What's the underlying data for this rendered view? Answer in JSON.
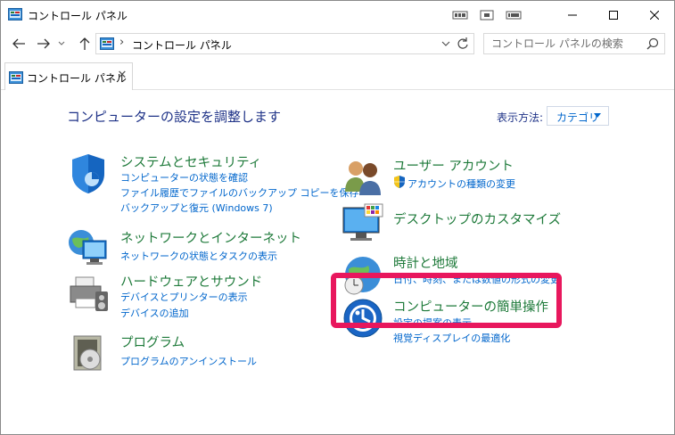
{
  "window": {
    "title": "コントロール パネル",
    "controls": {
      "minimize": "—",
      "maximize": "☐",
      "close": "✕"
    }
  },
  "nav": {
    "back_icon": "back-arrow-icon",
    "forward_icon": "forward-arrow-icon",
    "up_icon": "up-arrow-icon",
    "breadcrumb_root": "コントロール パネル",
    "search_placeholder": "コントロール パネルの検索"
  },
  "tab": {
    "label": "コントロール パネル"
  },
  "main": {
    "heading": "コンピューターの設定を調整します",
    "view_by_label": "表示方法:",
    "view_by_value": "カテゴリ"
  },
  "categories": [
    {
      "title": "システムとセキュリティ",
      "links": [
        "コンピューターの状態を確認",
        "ファイル履歴でファイルのバックアップ コピーを保存",
        "バックアップと復元 (Windows 7)"
      ],
      "icon": "shield-icon"
    },
    {
      "title": "ネットワークとインターネット",
      "links": [
        "ネットワークの状態とタスクの表示"
      ],
      "icon": "network-globe-icon"
    },
    {
      "title": "ハードウェアとサウンド",
      "links": [
        "デバイスとプリンターの表示",
        "デバイスの追加"
      ],
      "icon": "printer-icon"
    },
    {
      "title": "プログラム",
      "links": [
        "プログラムのアンインストール"
      ],
      "icon": "programs-disc-icon"
    },
    {
      "title": "ユーザー アカウント",
      "links": [
        "アカウントの種類の変更"
      ],
      "icon": "users-icon"
    },
    {
      "title": "デスクトップのカスタマイズ",
      "links": [],
      "icon": "monitor-icon"
    },
    {
      "title": "時計と地域",
      "links": [
        "日付、時刻、または数値の形式の変更"
      ],
      "icon": "clock-globe-icon"
    },
    {
      "title": "コンピューターの簡単操作",
      "links": [
        "設定の提案の表示",
        "視覚ディスプレイの最適化"
      ],
      "icon": "ease-of-access-icon"
    }
  ],
  "colors": {
    "category_title": "#1e7a3a",
    "link": "#0066cc",
    "heading": "#1e3287",
    "highlight": "#e8175d"
  }
}
